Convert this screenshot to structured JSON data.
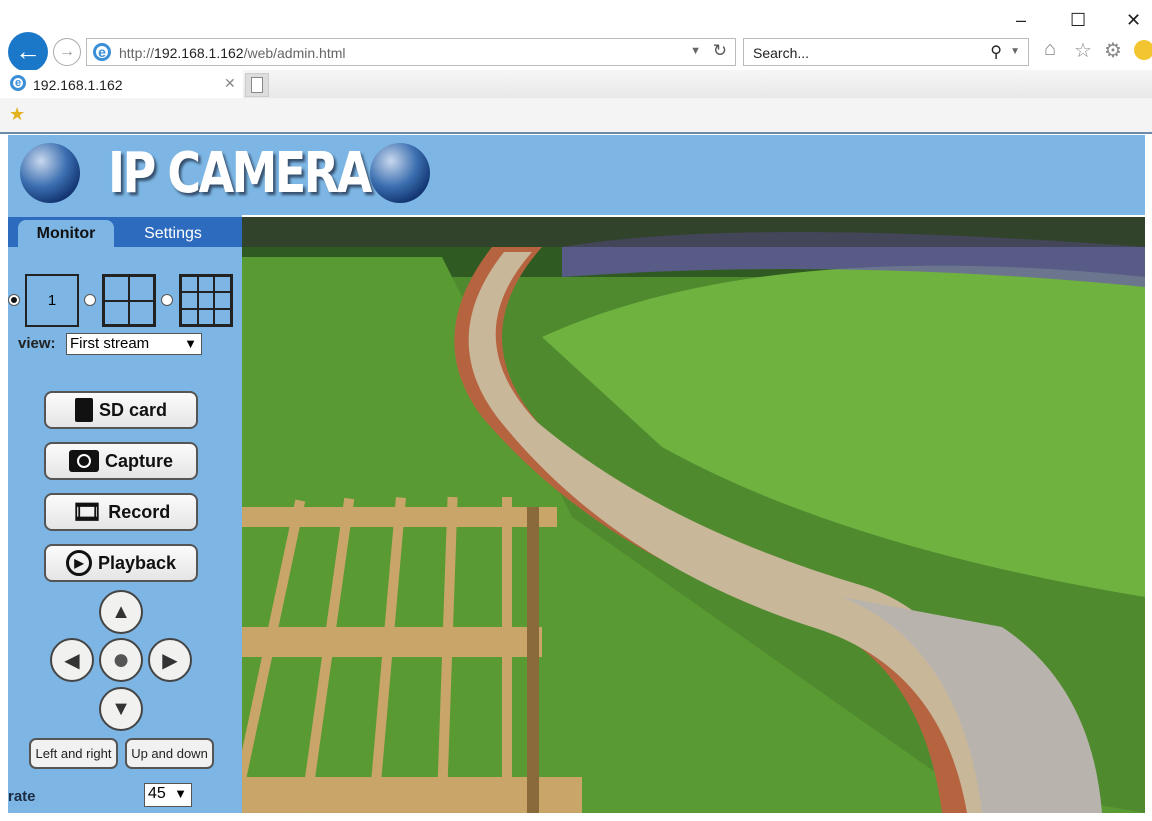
{
  "browser": {
    "url_prefix": "http://",
    "url_host": "192.168.1.162",
    "url_path": "/web/admin.html",
    "search_placeholder": "Search...",
    "tab_title": "192.168.1.162",
    "window_controls": {
      "minimize": "–",
      "maximize": "☐",
      "close": "✕"
    },
    "icons": [
      "back-icon",
      "forward-icon",
      "ie-icon",
      "refresh-icon",
      "search-icon",
      "home-icon",
      "favorites-icon",
      "settings-icon",
      "smiley-icon",
      "new-tab-icon",
      "favorites-bar-icon"
    ]
  },
  "banner": {
    "title": "IP CAMERA"
  },
  "sidebar": {
    "tabs": [
      {
        "label": "Monitor",
        "active": true
      },
      {
        "label": "Settings",
        "active": false
      }
    ],
    "layout_single_label": "1",
    "view_label": "view:",
    "view_value": "First stream",
    "buttons": [
      {
        "label": "SD card"
      },
      {
        "label": "Capture"
      },
      {
        "label": "Record"
      },
      {
        "label": "Playback"
      }
    ],
    "ptz": {
      "up": "▲",
      "down": "▼",
      "left": "◀",
      "right": "▶",
      "center": "●"
    },
    "cruise_lr": "Left and right",
    "cruise_ud": "Up and down",
    "rate_label": "rate",
    "rate_value": "45"
  },
  "colors": {
    "panel": "#7db6e4",
    "tabbar": "#2c6bbd"
  }
}
